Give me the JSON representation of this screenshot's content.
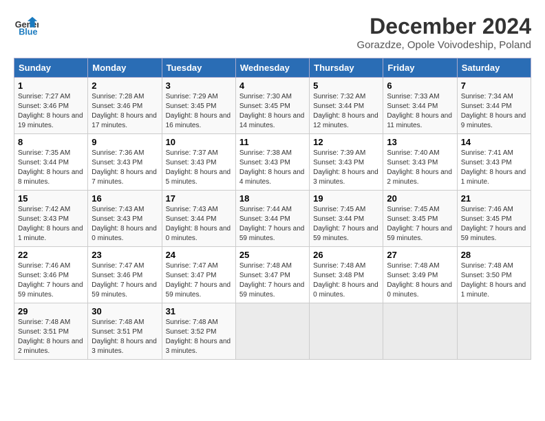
{
  "header": {
    "logo_line1": "General",
    "logo_line2": "Blue",
    "month": "December 2024",
    "location": "Gorazdze, Opole Voivodeship, Poland"
  },
  "weekdays": [
    "Sunday",
    "Monday",
    "Tuesday",
    "Wednesday",
    "Thursday",
    "Friday",
    "Saturday"
  ],
  "weeks": [
    [
      {
        "day": "1",
        "sunrise": "Sunrise: 7:27 AM",
        "sunset": "Sunset: 3:46 PM",
        "daylight": "Daylight: 8 hours and 19 minutes."
      },
      {
        "day": "2",
        "sunrise": "Sunrise: 7:28 AM",
        "sunset": "Sunset: 3:46 PM",
        "daylight": "Daylight: 8 hours and 17 minutes."
      },
      {
        "day": "3",
        "sunrise": "Sunrise: 7:29 AM",
        "sunset": "Sunset: 3:45 PM",
        "daylight": "Daylight: 8 hours and 16 minutes."
      },
      {
        "day": "4",
        "sunrise": "Sunrise: 7:30 AM",
        "sunset": "Sunset: 3:45 PM",
        "daylight": "Daylight: 8 hours and 14 minutes."
      },
      {
        "day": "5",
        "sunrise": "Sunrise: 7:32 AM",
        "sunset": "Sunset: 3:44 PM",
        "daylight": "Daylight: 8 hours and 12 minutes."
      },
      {
        "day": "6",
        "sunrise": "Sunrise: 7:33 AM",
        "sunset": "Sunset: 3:44 PM",
        "daylight": "Daylight: 8 hours and 11 minutes."
      },
      {
        "day": "7",
        "sunrise": "Sunrise: 7:34 AM",
        "sunset": "Sunset: 3:44 PM",
        "daylight": "Daylight: 8 hours and 9 minutes."
      }
    ],
    [
      {
        "day": "8",
        "sunrise": "Sunrise: 7:35 AM",
        "sunset": "Sunset: 3:44 PM",
        "daylight": "Daylight: 8 hours and 8 minutes."
      },
      {
        "day": "9",
        "sunrise": "Sunrise: 7:36 AM",
        "sunset": "Sunset: 3:43 PM",
        "daylight": "Daylight: 8 hours and 7 minutes."
      },
      {
        "day": "10",
        "sunrise": "Sunrise: 7:37 AM",
        "sunset": "Sunset: 3:43 PM",
        "daylight": "Daylight: 8 hours and 5 minutes."
      },
      {
        "day": "11",
        "sunrise": "Sunrise: 7:38 AM",
        "sunset": "Sunset: 3:43 PM",
        "daylight": "Daylight: 8 hours and 4 minutes."
      },
      {
        "day": "12",
        "sunrise": "Sunrise: 7:39 AM",
        "sunset": "Sunset: 3:43 PM",
        "daylight": "Daylight: 8 hours and 3 minutes."
      },
      {
        "day": "13",
        "sunrise": "Sunrise: 7:40 AM",
        "sunset": "Sunset: 3:43 PM",
        "daylight": "Daylight: 8 hours and 2 minutes."
      },
      {
        "day": "14",
        "sunrise": "Sunrise: 7:41 AM",
        "sunset": "Sunset: 3:43 PM",
        "daylight": "Daylight: 8 hours and 1 minute."
      }
    ],
    [
      {
        "day": "15",
        "sunrise": "Sunrise: 7:42 AM",
        "sunset": "Sunset: 3:43 PM",
        "daylight": "Daylight: 8 hours and 1 minute."
      },
      {
        "day": "16",
        "sunrise": "Sunrise: 7:43 AM",
        "sunset": "Sunset: 3:43 PM",
        "daylight": "Daylight: 8 hours and 0 minutes."
      },
      {
        "day": "17",
        "sunrise": "Sunrise: 7:43 AM",
        "sunset": "Sunset: 3:44 PM",
        "daylight": "Daylight: 8 hours and 0 minutes."
      },
      {
        "day": "18",
        "sunrise": "Sunrise: 7:44 AM",
        "sunset": "Sunset: 3:44 PM",
        "daylight": "Daylight: 7 hours and 59 minutes."
      },
      {
        "day": "19",
        "sunrise": "Sunrise: 7:45 AM",
        "sunset": "Sunset: 3:44 PM",
        "daylight": "Daylight: 7 hours and 59 minutes."
      },
      {
        "day": "20",
        "sunrise": "Sunrise: 7:45 AM",
        "sunset": "Sunset: 3:45 PM",
        "daylight": "Daylight: 7 hours and 59 minutes."
      },
      {
        "day": "21",
        "sunrise": "Sunrise: 7:46 AM",
        "sunset": "Sunset: 3:45 PM",
        "daylight": "Daylight: 7 hours and 59 minutes."
      }
    ],
    [
      {
        "day": "22",
        "sunrise": "Sunrise: 7:46 AM",
        "sunset": "Sunset: 3:46 PM",
        "daylight": "Daylight: 7 hours and 59 minutes."
      },
      {
        "day": "23",
        "sunrise": "Sunrise: 7:47 AM",
        "sunset": "Sunset: 3:46 PM",
        "daylight": "Daylight: 7 hours and 59 minutes."
      },
      {
        "day": "24",
        "sunrise": "Sunrise: 7:47 AM",
        "sunset": "Sunset: 3:47 PM",
        "daylight": "Daylight: 7 hours and 59 minutes."
      },
      {
        "day": "25",
        "sunrise": "Sunrise: 7:48 AM",
        "sunset": "Sunset: 3:47 PM",
        "daylight": "Daylight: 7 hours and 59 minutes."
      },
      {
        "day": "26",
        "sunrise": "Sunrise: 7:48 AM",
        "sunset": "Sunset: 3:48 PM",
        "daylight": "Daylight: 8 hours and 0 minutes."
      },
      {
        "day": "27",
        "sunrise": "Sunrise: 7:48 AM",
        "sunset": "Sunset: 3:49 PM",
        "daylight": "Daylight: 8 hours and 0 minutes."
      },
      {
        "day": "28",
        "sunrise": "Sunrise: 7:48 AM",
        "sunset": "Sunset: 3:50 PM",
        "daylight": "Daylight: 8 hours and 1 minute."
      }
    ],
    [
      {
        "day": "29",
        "sunrise": "Sunrise: 7:48 AM",
        "sunset": "Sunset: 3:51 PM",
        "daylight": "Daylight: 8 hours and 2 minutes."
      },
      {
        "day": "30",
        "sunrise": "Sunrise: 7:48 AM",
        "sunset": "Sunset: 3:51 PM",
        "daylight": "Daylight: 8 hours and 3 minutes."
      },
      {
        "day": "31",
        "sunrise": "Sunrise: 7:48 AM",
        "sunset": "Sunset: 3:52 PM",
        "daylight": "Daylight: 8 hours and 3 minutes."
      },
      null,
      null,
      null,
      null
    ]
  ]
}
